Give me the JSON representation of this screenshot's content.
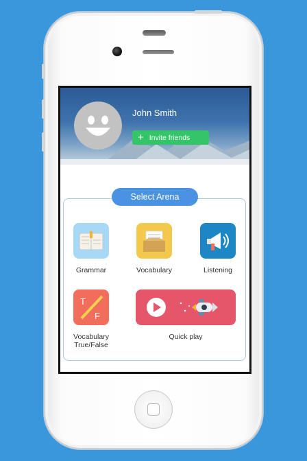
{
  "profile": {
    "name": "John Smith",
    "invite_label": "Invite friends",
    "invite_icon": "plus-icon"
  },
  "arena": {
    "title": "Select Arena",
    "items": [
      {
        "label": "Grammar",
        "icon": "book-icon",
        "color": "#a7d8f6"
      },
      {
        "label": "Vocabulary",
        "icon": "card-box-icon",
        "color": "#f2c94c"
      },
      {
        "label": "Listening",
        "icon": "megaphone-icon",
        "color": "#1d87c6"
      },
      {
        "label": "Vocabulary True/False",
        "line1": "Vocabulary",
        "line2": "True/False",
        "icon": "true-false-icon",
        "color": "#f16d5c"
      }
    ],
    "quick_play": {
      "label": "Quick play",
      "icon": "play-rocket-icon",
      "color": "#e6566a"
    }
  },
  "colors": {
    "background": "#3a97dc",
    "accent": "#4a92e2",
    "invite": "#34c46a"
  }
}
